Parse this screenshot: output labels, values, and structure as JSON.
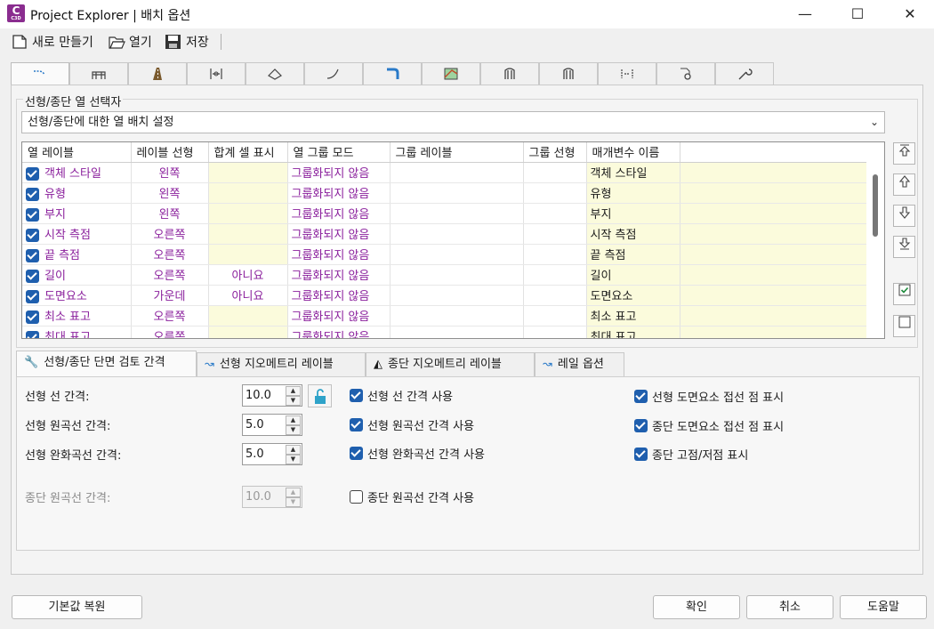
{
  "window": {
    "title": "Project Explorer | 배치 옵션",
    "app_icon_letter": "C",
    "app_icon_sub": "C3D",
    "controls": [
      "minimize",
      "maximize",
      "close"
    ]
  },
  "toolbar": {
    "new_label": "새로 만들기",
    "open_label": "열기",
    "save_label": "저장"
  },
  "top_tabs": [
    "alignment-icon",
    "bridge-icon",
    "road-icon",
    "axis-icon",
    "surface-icon",
    "profile-icon",
    "pipe-icon",
    "corridor-icon",
    "rail-icon",
    "rail2-icon",
    "measure-icon",
    "search-doc-icon",
    "wrench-icon"
  ],
  "group": {
    "label": "선형/종단 열 선택자",
    "combo_value": "선형/종단에 대한 열 배치 설정"
  },
  "grid": {
    "headers": [
      "열 레이블",
      "레이블 선형",
      "합계 셀 표시",
      "열 그룹 모드",
      "그룹 레이블",
      "그룹 선형",
      "매개변수 이름"
    ],
    "rows": [
      {
        "label": "객체 스타일",
        "align": "왼쪽",
        "sum": "",
        "group_mode": "그룹화되지 않음",
        "param": "객체 스타일"
      },
      {
        "label": "유형",
        "align": "왼쪽",
        "sum": "",
        "group_mode": "그룹화되지 않음",
        "param": "유형"
      },
      {
        "label": "부지",
        "align": "왼쪽",
        "sum": "",
        "group_mode": "그룹화되지 않음",
        "param": "부지"
      },
      {
        "label": "시작 측점",
        "align": "오른쪽",
        "sum": "",
        "group_mode": "그룹화되지 않음",
        "param": "시작 측점"
      },
      {
        "label": "끝 측점",
        "align": "오른쪽",
        "sum": "",
        "group_mode": "그룹화되지 않음",
        "param": "끝 측점"
      },
      {
        "label": "길이",
        "align": "오른쪽",
        "sum": "아니요",
        "group_mode": "그룹화되지 않음",
        "param": "길이"
      },
      {
        "label": "도면요소",
        "align": "가운데",
        "sum": "아니요",
        "group_mode": "그룹화되지 않음",
        "param": "도면요소"
      },
      {
        "label": "최소 표고",
        "align": "오른쪽",
        "sum": "",
        "group_mode": "그룹화되지 않음",
        "param": "최소 표고"
      },
      {
        "label": "최대 표고",
        "align": "오른쪽",
        "sum": "",
        "group_mode": "그룹화되지 않음",
        "param": "최대 표고"
      }
    ]
  },
  "side_buttons": [
    "move-top-icon",
    "move-up-icon",
    "move-down-icon",
    "move-bottom-icon",
    "check-all-icon",
    "uncheck-all-icon"
  ],
  "lower_tabs": {
    "t1": "선형/종단 단면 검토 간격",
    "t2": "선형 지오메트리 레이블",
    "t3": "종단 지오메트리 레이블",
    "t4": "레일 옵션"
  },
  "settings": {
    "align_line_label": "선형 선 간격:",
    "align_line_value": "10.0",
    "align_curve_label": "선형 원곡선 간격:",
    "align_curve_value": "5.0",
    "align_spiral_label": "선형 완화곡선 간격:",
    "align_spiral_value": "5.0",
    "profile_curve_label": "종단 원곡선 간격:",
    "profile_curve_value": "10.0",
    "use_align_line": "선형 선 간격 사용",
    "use_align_curve": "선형 원곡선 간격 사용",
    "use_align_spiral": "선형 완화곡선 간격 사용",
    "use_profile_curve": "종단 원곡선 간격 사용",
    "show_align_tangent": "선형 도면요소 접선 점 표시",
    "show_profile_tangent": "종단 도면요소 접선 점 표시",
    "show_high_low": "종단 고점/저점 표시"
  },
  "footer": {
    "restore_label": "기본값 복원",
    "ok_label": "확인",
    "cancel_label": "취소",
    "help_label": "도움말"
  },
  "colors": {
    "accent": "#1f5fae",
    "purple_text": "#8a1f9c",
    "yellow_cell": "#fbfbdc"
  }
}
